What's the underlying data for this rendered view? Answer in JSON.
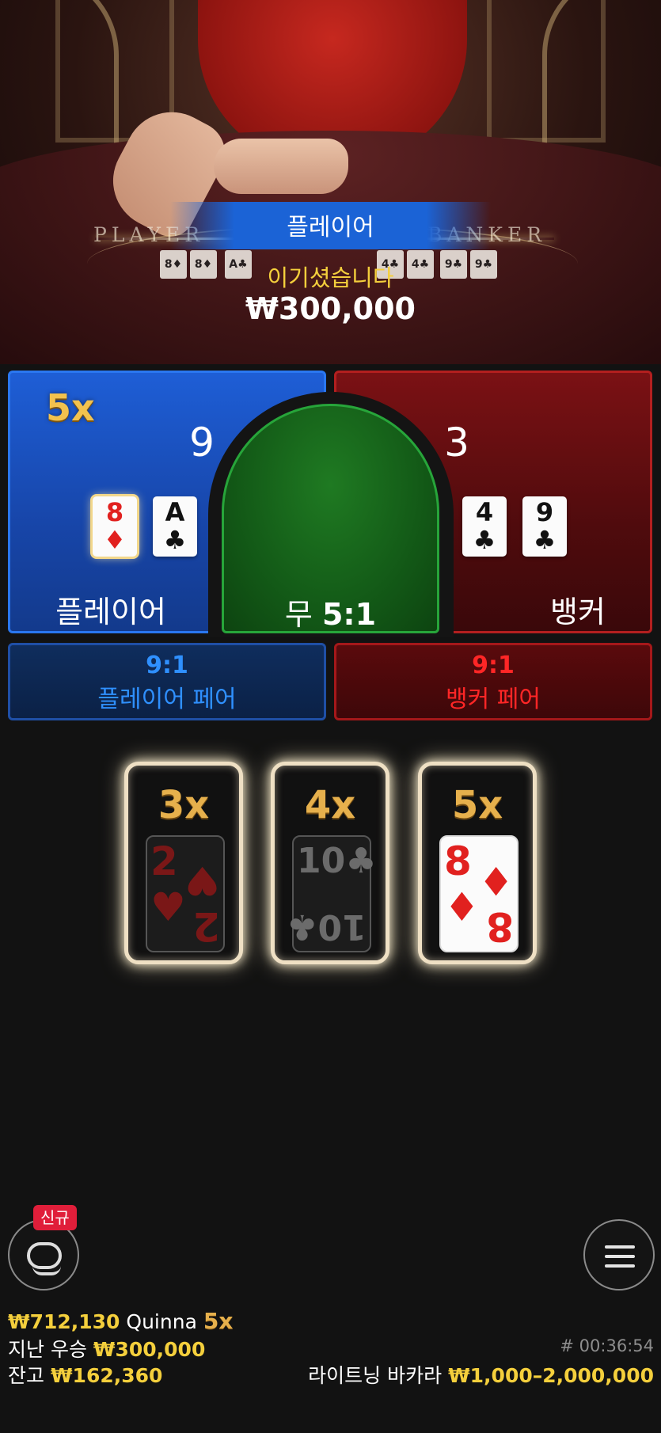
{
  "result": {
    "title": "플레이어",
    "message": "이기셨습니다",
    "amount": "₩300,000"
  },
  "table_text": {
    "player": "PLAYER",
    "banker": "BANKER"
  },
  "player": {
    "multiplier": "5x",
    "score": "9",
    "label": "플레이어",
    "cards": [
      {
        "rank": "8",
        "suit": "♦"
      },
      {
        "rank": "A",
        "suit": "♣"
      }
    ]
  },
  "banker": {
    "score": "3",
    "label": "뱅커",
    "cards": [
      {
        "rank": "4",
        "suit": "♣"
      },
      {
        "rank": "9",
        "suit": "♣"
      }
    ]
  },
  "tie": {
    "label": "무",
    "odds": "5:1"
  },
  "player_pair": {
    "odds": "9:1",
    "label": "플레이어 페어"
  },
  "banker_pair": {
    "odds": "9:1",
    "label": "뱅커 페어"
  },
  "lightning_cards": [
    {
      "multiplier": "3x",
      "rank": "2",
      "suit": "♥"
    },
    {
      "multiplier": "4x",
      "rank": "10",
      "suit": "♣"
    },
    {
      "multiplier": "5x",
      "rank": "8",
      "suit": "♦"
    }
  ],
  "chat": {
    "badge": "신규"
  },
  "footer": {
    "last_win_amount": "₩712,130",
    "last_win_player": "Quinna",
    "last_win_multiplier": "5x",
    "last_win_label": "지난 우승",
    "last_win_total": "₩300,000",
    "balance_label": "잔고",
    "balance": "₩162,360",
    "round_id": "# 00:36:54",
    "game_name": "라이트닝 바카라",
    "limits": "₩1,000–2,000,000"
  },
  "colors": {
    "player_blue": "#1e5ed6",
    "banker_red": "#7b1114",
    "tie_green": "#1f7a22",
    "gold": "#f4cf3c"
  }
}
